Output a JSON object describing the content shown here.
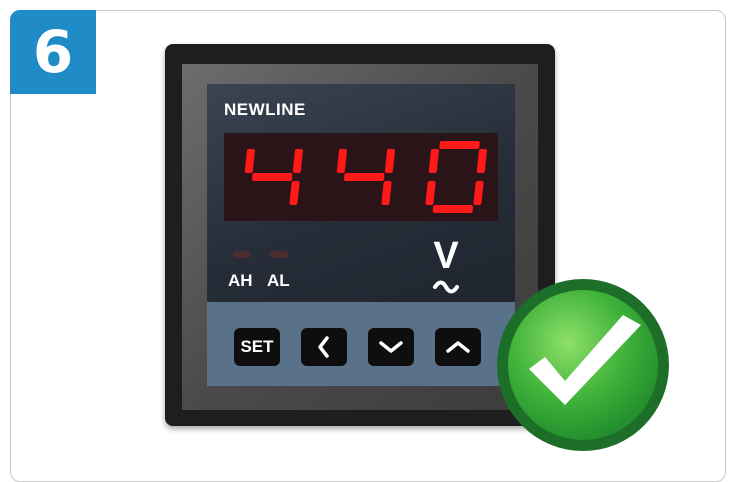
{
  "step": {
    "number": "6"
  },
  "meter": {
    "brand": "NEWLINE",
    "reading": "440",
    "indicators": [
      {
        "label": "AH",
        "state": "off"
      },
      {
        "label": "AL",
        "state": "off"
      }
    ],
    "unit_symbol": "V",
    "unit_type": "AC (tilde)",
    "buttons": [
      {
        "label": "SET",
        "icon": "text"
      },
      {
        "label": "",
        "icon": "chevron-left-icon"
      },
      {
        "label": "",
        "icon": "chevron-down-icon"
      },
      {
        "label": "",
        "icon": "chevron-up-icon"
      }
    ]
  },
  "status": {
    "icon": "checkmark-icon",
    "state": "correct"
  },
  "colors": {
    "badge": "#1f8cc7",
    "segment_on": "#ff1a1a",
    "display_bg": "#2a1417",
    "button_strip": "#59728a",
    "check_green": "#2aa035"
  }
}
